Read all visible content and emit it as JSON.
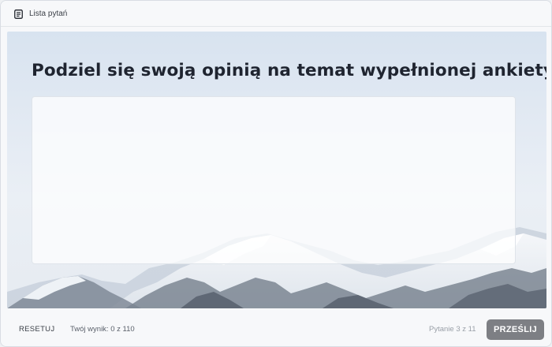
{
  "header": {
    "list_label": "Lista pytań"
  },
  "question": {
    "title": "Podziel się swoją opinią na temat wypełnionej ankiety",
    "answer_value": ""
  },
  "footer": {
    "reset_label": "RESETUJ",
    "score_text": "Twój wynik: 0 z 110",
    "progress_text": "Pytanie 3 z 11",
    "submit_label": "PRZEŚLIJ"
  },
  "icons": {
    "list": "list-icon"
  },
  "colors": {
    "submit_button": "#7d7f84",
    "title_text": "#1f2430"
  }
}
